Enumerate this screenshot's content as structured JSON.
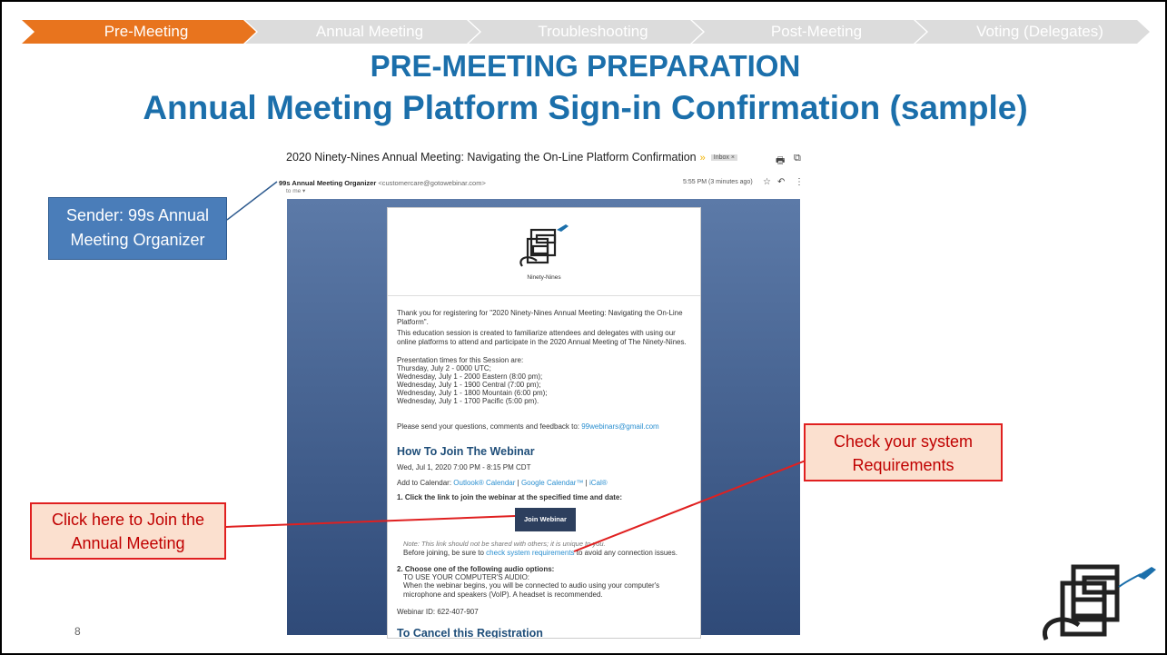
{
  "breadcrumbs": [
    {
      "label": "Pre-Meeting",
      "active": true
    },
    {
      "label": "Annual Meeting",
      "active": false
    },
    {
      "label": "Troubleshooting",
      "active": false
    },
    {
      "label": "Post-Meeting",
      "active": false
    },
    {
      "label": "Voting (Delegates)",
      "active": false
    }
  ],
  "colors": {
    "active_crumb": "#e8741e",
    "inactive_crumb": "#dcdcdc",
    "title": "#1b6fab",
    "callout_red_border": "#e02020",
    "callout_blue": "#4a7db9"
  },
  "title_line1": "PRE-MEETING PREPARATION",
  "title_line2": "Annual Meeting Platform Sign-in Confirmation (sample)",
  "email": {
    "subject": "2020 Ninety-Nines Annual Meeting: Navigating the On-Line Platform Confirmation",
    "inbox_tag": "Inbox ×",
    "sender_name": "99s Annual Meeting Organizer",
    "sender_address": "<customercare@gotowebinar.com>",
    "to_me": "to me ▾",
    "time": "5:55 PM (3 minutes ago)",
    "logo_caption": "Ninety-Nines",
    "para1": "Thank you for registering for \"2020 Ninety-Nines Annual Meeting: Navigating the On-Line Platform\".",
    "para2": "This education session is created to familiarize attendees and delegates with using our online platforms to attend and participate in the 2020 Annual Meeting of The Ninety-Nines.",
    "times_intro": "Presentation times for this Session are:",
    "times": [
      "Thursday, July 2 - 0000 UTC;",
      "Wednesday, July 1 - 2000 Eastern (8:00 pm);",
      "Wednesday, July 1 - 1900 Central (7:00 pm);",
      "Wednesday, July 1 - 1800 Mountain (6:00 pm);",
      "Wednesday, July 1 - 1700 Pacific (5:00 pm)."
    ],
    "feedback_text": "Please send your questions, comments and feedback to: ",
    "feedback_email": "99webinars@gmail.com",
    "how_to_join": "How To Join The Webinar",
    "datetime": "Wed, Jul 1, 2020 7:00 PM - 8:15 PM CDT",
    "add_calendar": "Add to Calendar: ",
    "cal_outlook": "Outlook® Calendar",
    "cal_google": "Google Calendar™",
    "cal_ical": "iCal®",
    "step1": "1. Click the link to join the webinar at the specified time and date:",
    "join_button": "Join Webinar",
    "note": "Note: This link should not be shared with others; it is unique to you.",
    "before_joining_a": "Before joining, be sure to ",
    "before_joining_link": "check system requirements",
    "before_joining_b": " to avoid any connection issues.",
    "step2": "2. Choose one of the following audio options:",
    "audio_head": "TO USE YOUR COMPUTER'S AUDIO:",
    "audio_text": "When the webinar begins, you will be connected to audio using your computer's microphone and speakers (VoIP). A headset is recommended.",
    "webinar_id": "Webinar ID: 622-407-907",
    "cut_heading": "To Cancel this Registration"
  },
  "callouts": {
    "sender": "Sender: 99s Annual Meeting Organizer",
    "join": "Click here to Join the Annual Meeting",
    "requirements": "Check your system Requirements"
  },
  "page_number": "8"
}
